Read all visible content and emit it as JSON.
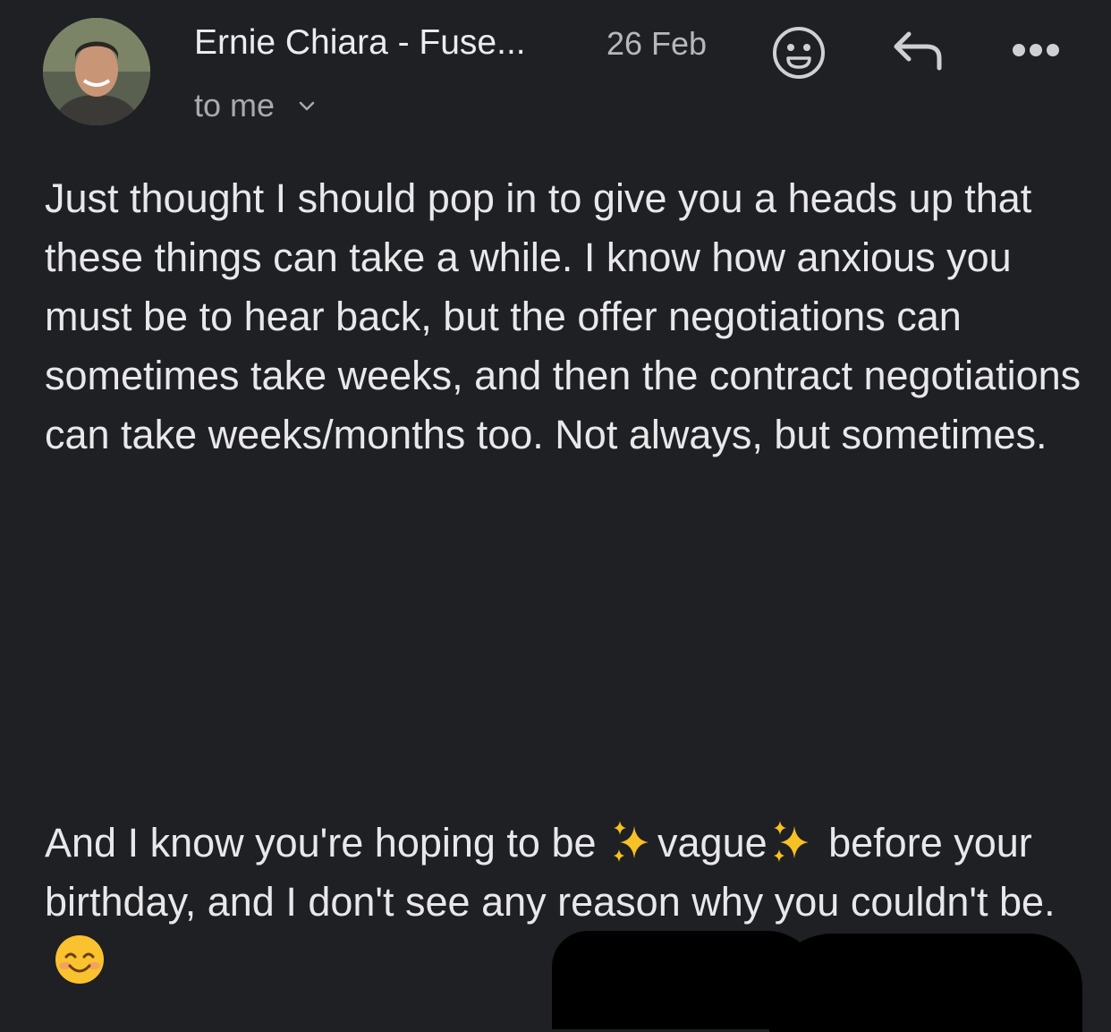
{
  "header": {
    "sender": "Ernie Chiara - Fuse...",
    "date": "26 Feb",
    "recipient": "to me",
    "icons": {
      "avatar": "sender-avatar-photo",
      "emoji_reaction": "smiley-face-icon",
      "reply": "reply-arrow-icon",
      "more": "more-options-icon",
      "recipient_toggle": "chevron-down-icon"
    }
  },
  "body": {
    "paragraph1": "Just thought I should pop in to give you a heads up that these things can take a while. I know how anxious you must be to hear back, but the offer negotiations can sometimes take weeks, and then the contract negotiations can take weeks/months too. Not always, but sometimes.",
    "paragraph2": {
      "text_before": "And I know you're hoping to be ",
      "highlight": "vague",
      "text_after": " before your birthday, and I don't see any reason why you couldn't be."
    }
  },
  "colors": {
    "background": "#1f2023",
    "text": "#e8e8ea",
    "secondary_text": "#a9aaae",
    "redaction": "#000000"
  }
}
